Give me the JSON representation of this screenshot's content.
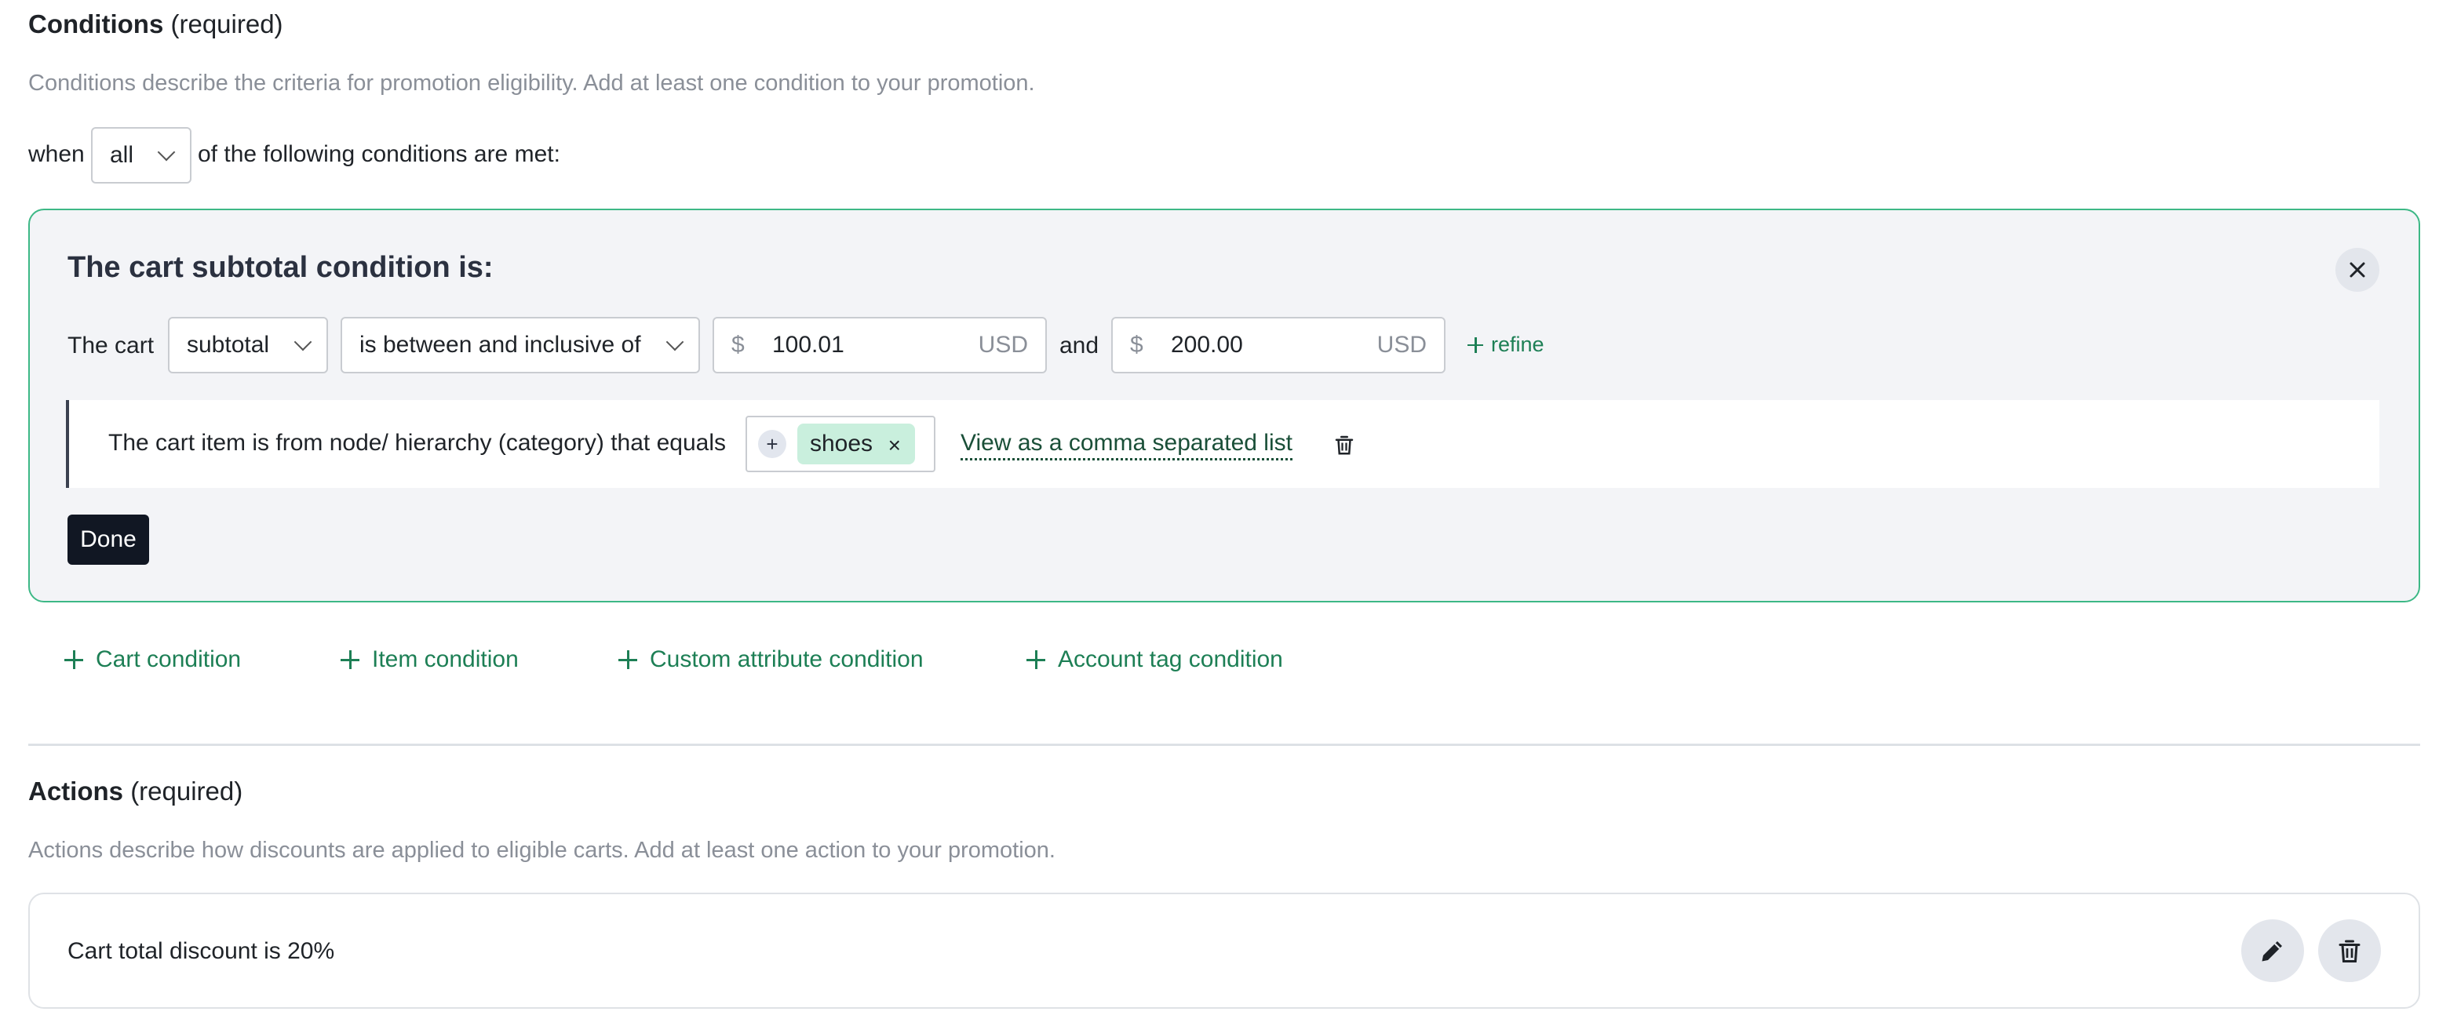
{
  "conditions": {
    "title": "Conditions",
    "required_label": "(required)",
    "description": "Conditions describe the criteria for promotion eligibility. Add at least one condition to your promotion.",
    "when_prefix": "when",
    "match_select_value": "all",
    "when_suffix": "of the following conditions are met:"
  },
  "cart_panel": {
    "heading": "The cart subtotal condition is:",
    "row_prefix": "The cart",
    "field_select_value": "subtotal",
    "operator_select_value": "is between and inclusive of",
    "min": {
      "currency_symbol": "$",
      "value": "100.01",
      "unit": "USD"
    },
    "between_label": "and",
    "max": {
      "currency_symbol": "$",
      "value": "200.00",
      "unit": "USD"
    },
    "refine_label": "refine",
    "sub_condition": {
      "text": "The cart item is from node/ hierarchy (category) that equals",
      "add_symbol": "+",
      "chip_label": "shoes",
      "chip_remove": "×",
      "view_link": "View as a comma separated list"
    },
    "done_label": "Done"
  },
  "add_condition_links": [
    {
      "label": "Cart condition"
    },
    {
      "label": "Item condition"
    },
    {
      "label": "Custom attribute condition"
    },
    {
      "label": "Account tag condition"
    }
  ],
  "actions": {
    "title": "Actions",
    "required_label": "(required)",
    "description": "Actions describe how discounts are applied to eligible carts. Add at least one action to your promotion.",
    "items": [
      {
        "text": "Cart total discount is 20%"
      }
    ]
  },
  "icons": {
    "close": "close-icon",
    "trash": "trash-icon",
    "edit": "pencil-icon",
    "plus": "plus-icon",
    "chevron": "chevron-down-icon"
  },
  "colors": {
    "accent_green": "#1d7f55",
    "panel_border": "#3db886",
    "chip_bg": "#c9efdd",
    "done_bg": "#111723"
  }
}
